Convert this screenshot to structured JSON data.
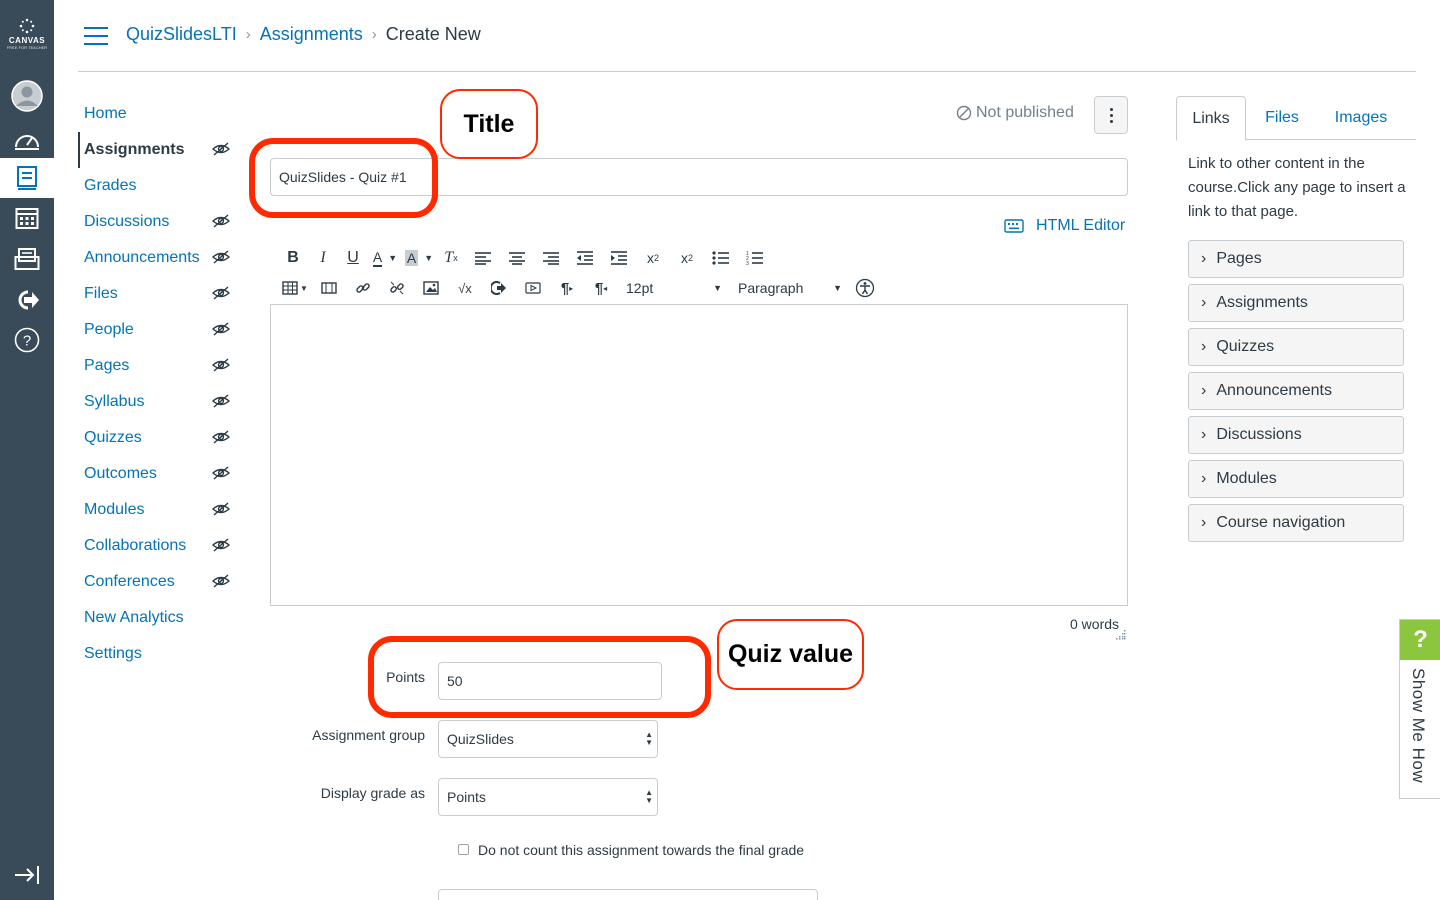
{
  "global_nav": {
    "logo_text": "CANVAS",
    "logo_sub": "FREE FOR TEACHER"
  },
  "breadcrumb": [
    "QuizSlidesLTI",
    "Assignments",
    "Create New"
  ],
  "course_nav": [
    {
      "label": "Home",
      "hidden": false
    },
    {
      "label": "Assignments",
      "hidden": true,
      "active": true
    },
    {
      "label": "Grades",
      "hidden": false
    },
    {
      "label": "Discussions",
      "hidden": true
    },
    {
      "label": "Announcements",
      "hidden": true
    },
    {
      "label": "Files",
      "hidden": true
    },
    {
      "label": "People",
      "hidden": true
    },
    {
      "label": "Pages",
      "hidden": true
    },
    {
      "label": "Syllabus",
      "hidden": true
    },
    {
      "label": "Quizzes",
      "hidden": true
    },
    {
      "label": "Outcomes",
      "hidden": true
    },
    {
      "label": "Modules",
      "hidden": true
    },
    {
      "label": "Collaborations",
      "hidden": true
    },
    {
      "label": "Conferences",
      "hidden": true
    },
    {
      "label": "New Analytics",
      "hidden": false
    },
    {
      "label": "Settings",
      "hidden": false
    }
  ],
  "main": {
    "publish_status": "Not published",
    "title_value": "QuizSlides - Quiz #1",
    "html_editor_label": "HTML Editor",
    "font_size": "12pt",
    "block_format": "Paragraph",
    "word_count": "0 words",
    "points_label": "Points",
    "points_value": "50",
    "assignment_group_label": "Assignment group",
    "assignment_group_value": "QuizSlides",
    "display_grade_label": "Display grade as",
    "display_grade_value": "Points",
    "omit_checkbox_label": "Do not count this assignment towards the final grade"
  },
  "annotations": {
    "title_callout": "Title",
    "quiz_value_callout": "Quiz value",
    "accent": "#ff2a00"
  },
  "sidebar": {
    "tabs": [
      "Links",
      "Files",
      "Images"
    ],
    "hint": "Link to other content in the course.Click any page to insert a link to that page.",
    "sections": [
      "Pages",
      "Assignments",
      "Quizzes",
      "Announcements",
      "Discussions",
      "Modules",
      "Course navigation"
    ]
  },
  "show_me_how": {
    "icon": "?",
    "label": "Show Me How"
  },
  "colors": {
    "link": "#0374b5",
    "nav_bg": "#394b58",
    "text": "#2d3b45",
    "callout": "#ff2a00",
    "help_green": "#8cc63f"
  }
}
